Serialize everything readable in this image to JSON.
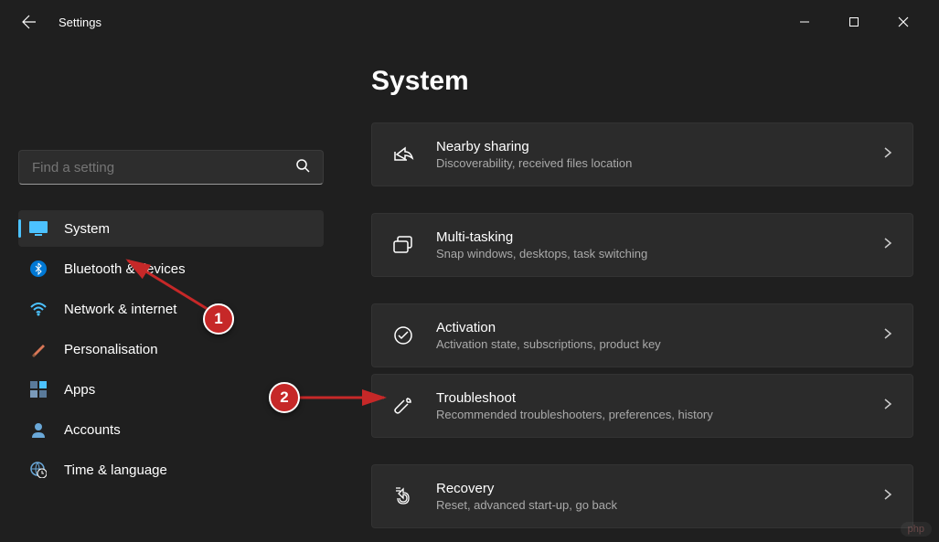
{
  "app": {
    "title": "Settings"
  },
  "search": {
    "placeholder": "Find a setting"
  },
  "sidebar": {
    "items": [
      {
        "label": "System",
        "icon": "display-icon",
        "active": true
      },
      {
        "label": "Bluetooth & devices",
        "icon": "bluetooth-icon"
      },
      {
        "label": "Network & internet",
        "icon": "wifi-icon"
      },
      {
        "label": "Personalisation",
        "icon": "brush-icon"
      },
      {
        "label": "Apps",
        "icon": "apps-icon"
      },
      {
        "label": "Accounts",
        "icon": "person-icon"
      },
      {
        "label": "Time & language",
        "icon": "globe-clock-icon"
      }
    ]
  },
  "page": {
    "title": "System"
  },
  "cards": [
    {
      "title": "Nearby sharing",
      "desc": "Discoverability, received files location",
      "icon": "share-icon"
    },
    {
      "title": "Multi-tasking",
      "desc": "Snap windows, desktops, task switching",
      "icon": "windows-stack-icon"
    },
    {
      "title": "Activation",
      "desc": "Activation state, subscriptions, product key",
      "icon": "check-circle-icon"
    },
    {
      "title": "Troubleshoot",
      "desc": "Recommended troubleshooters, preferences, history",
      "icon": "wrench-icon"
    },
    {
      "title": "Recovery",
      "desc": "Reset, advanced start-up, go back",
      "icon": "recovery-icon"
    }
  ],
  "annotations": {
    "marker1": "1",
    "marker2": "2"
  },
  "watermark": "php"
}
